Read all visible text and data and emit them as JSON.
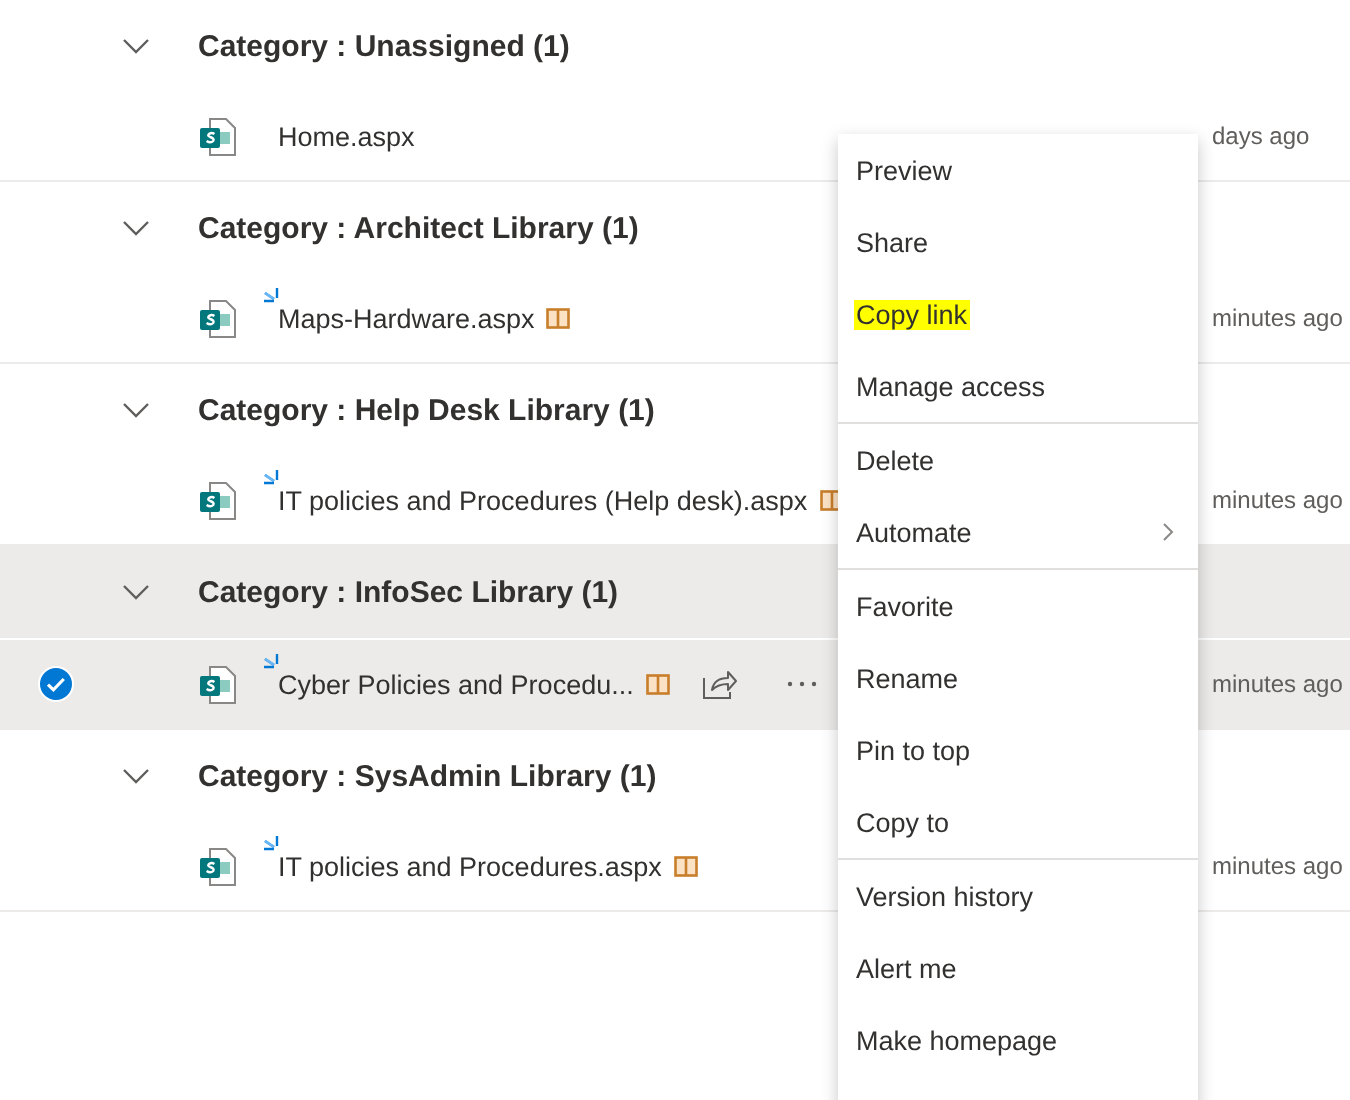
{
  "groups": [
    {
      "title": "Category : Unassigned (1)",
      "expanded": true,
      "highlighted": false,
      "items": [
        {
          "name": "Home.aspx",
          "new": false,
          "book": false,
          "selected": false,
          "time": "days ago"
        }
      ]
    },
    {
      "title": "Category : Architect Library (1)",
      "expanded": true,
      "highlighted": false,
      "items": [
        {
          "name": "Maps-Hardware.aspx",
          "new": true,
          "book": true,
          "selected": false,
          "time": "minutes ago"
        }
      ]
    },
    {
      "title": "Category : Help Desk Library (1)",
      "expanded": true,
      "highlighted": false,
      "items": [
        {
          "name": "IT policies and Procedures (Help desk).aspx",
          "new": true,
          "book": true,
          "selected": false,
          "time": "minutes ago"
        }
      ]
    },
    {
      "title": "Category : InfoSec Library (1)",
      "expanded": true,
      "highlighted": true,
      "items": [
        {
          "name": "Cyber Policies and Procedu...",
          "new": true,
          "book": true,
          "selected": true,
          "time": "minutes ago"
        }
      ]
    },
    {
      "title": "Category : SysAdmin Library (1)",
      "expanded": true,
      "highlighted": false,
      "items": [
        {
          "name": "IT policies and Procedures.aspx",
          "new": true,
          "book": true,
          "selected": false,
          "time": "minutes ago"
        }
      ]
    }
  ],
  "menu": {
    "sections": [
      [
        {
          "label": "Preview",
          "kind": "item",
          "highlighted": false
        },
        {
          "label": "Share",
          "kind": "item",
          "highlighted": false
        },
        {
          "label": "Copy link",
          "kind": "item",
          "highlighted": true
        },
        {
          "label": "Manage access",
          "kind": "item",
          "highlighted": false
        }
      ],
      [
        {
          "label": "Delete",
          "kind": "item",
          "highlighted": false
        },
        {
          "label": "Automate",
          "kind": "submenu",
          "highlighted": false
        }
      ],
      [
        {
          "label": "Favorite",
          "kind": "item",
          "highlighted": false
        },
        {
          "label": "Rename",
          "kind": "item",
          "highlighted": false
        },
        {
          "label": "Pin to top",
          "kind": "item",
          "highlighted": false
        },
        {
          "label": "Copy to",
          "kind": "item",
          "highlighted": false
        }
      ],
      [
        {
          "label": "Version history",
          "kind": "item",
          "highlighted": false
        },
        {
          "label": "Alert me",
          "kind": "item",
          "highlighted": false
        },
        {
          "label": "Make homepage",
          "kind": "item",
          "highlighted": false
        }
      ]
    ]
  }
}
